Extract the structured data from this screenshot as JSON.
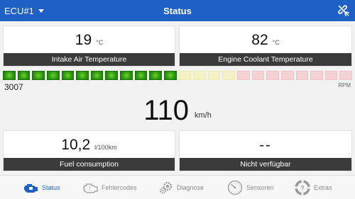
{
  "topbar": {
    "ecu_label": "ECU#1",
    "title": "Status"
  },
  "cards": {
    "intake": {
      "value": "19",
      "unit": "°C",
      "label": "Intake Air Temperature"
    },
    "coolant": {
      "value": "82",
      "unit": "°C",
      "label": "Engine Coolant Temperature"
    },
    "fuel": {
      "value": "10,2",
      "unit": "l/100km",
      "label": "Fuel consumption"
    },
    "unavailable": {
      "value": "--",
      "label": "Nicht verfügbar"
    }
  },
  "rpm": {
    "value": "3007",
    "unit": "RPM",
    "segments_total": 24,
    "segments_green": 12,
    "segments_yellow": 4,
    "segments_red": 8
  },
  "speed": {
    "value": "110",
    "unit": "km/h"
  },
  "tabs": [
    {
      "label": "Status",
      "icon": "engine-icon",
      "active": true
    },
    {
      "label": "Fehlercodes",
      "icon": "engine-warning-icon",
      "active": false
    },
    {
      "label": "Diagnose",
      "icon": "gears-icon",
      "active": false
    },
    {
      "label": "Sensoren",
      "icon": "gauge-icon",
      "active": false
    },
    {
      "label": "Extras",
      "icon": "lifebuoy-icon",
      "active": false
    }
  ],
  "colors": {
    "accent": "#1e60c6",
    "label_bar": "#3b3b3b",
    "rpm_green": "#2f9e12",
    "rpm_yellow": "#f4f2c4",
    "rpm_red": "#f4d2d4"
  }
}
